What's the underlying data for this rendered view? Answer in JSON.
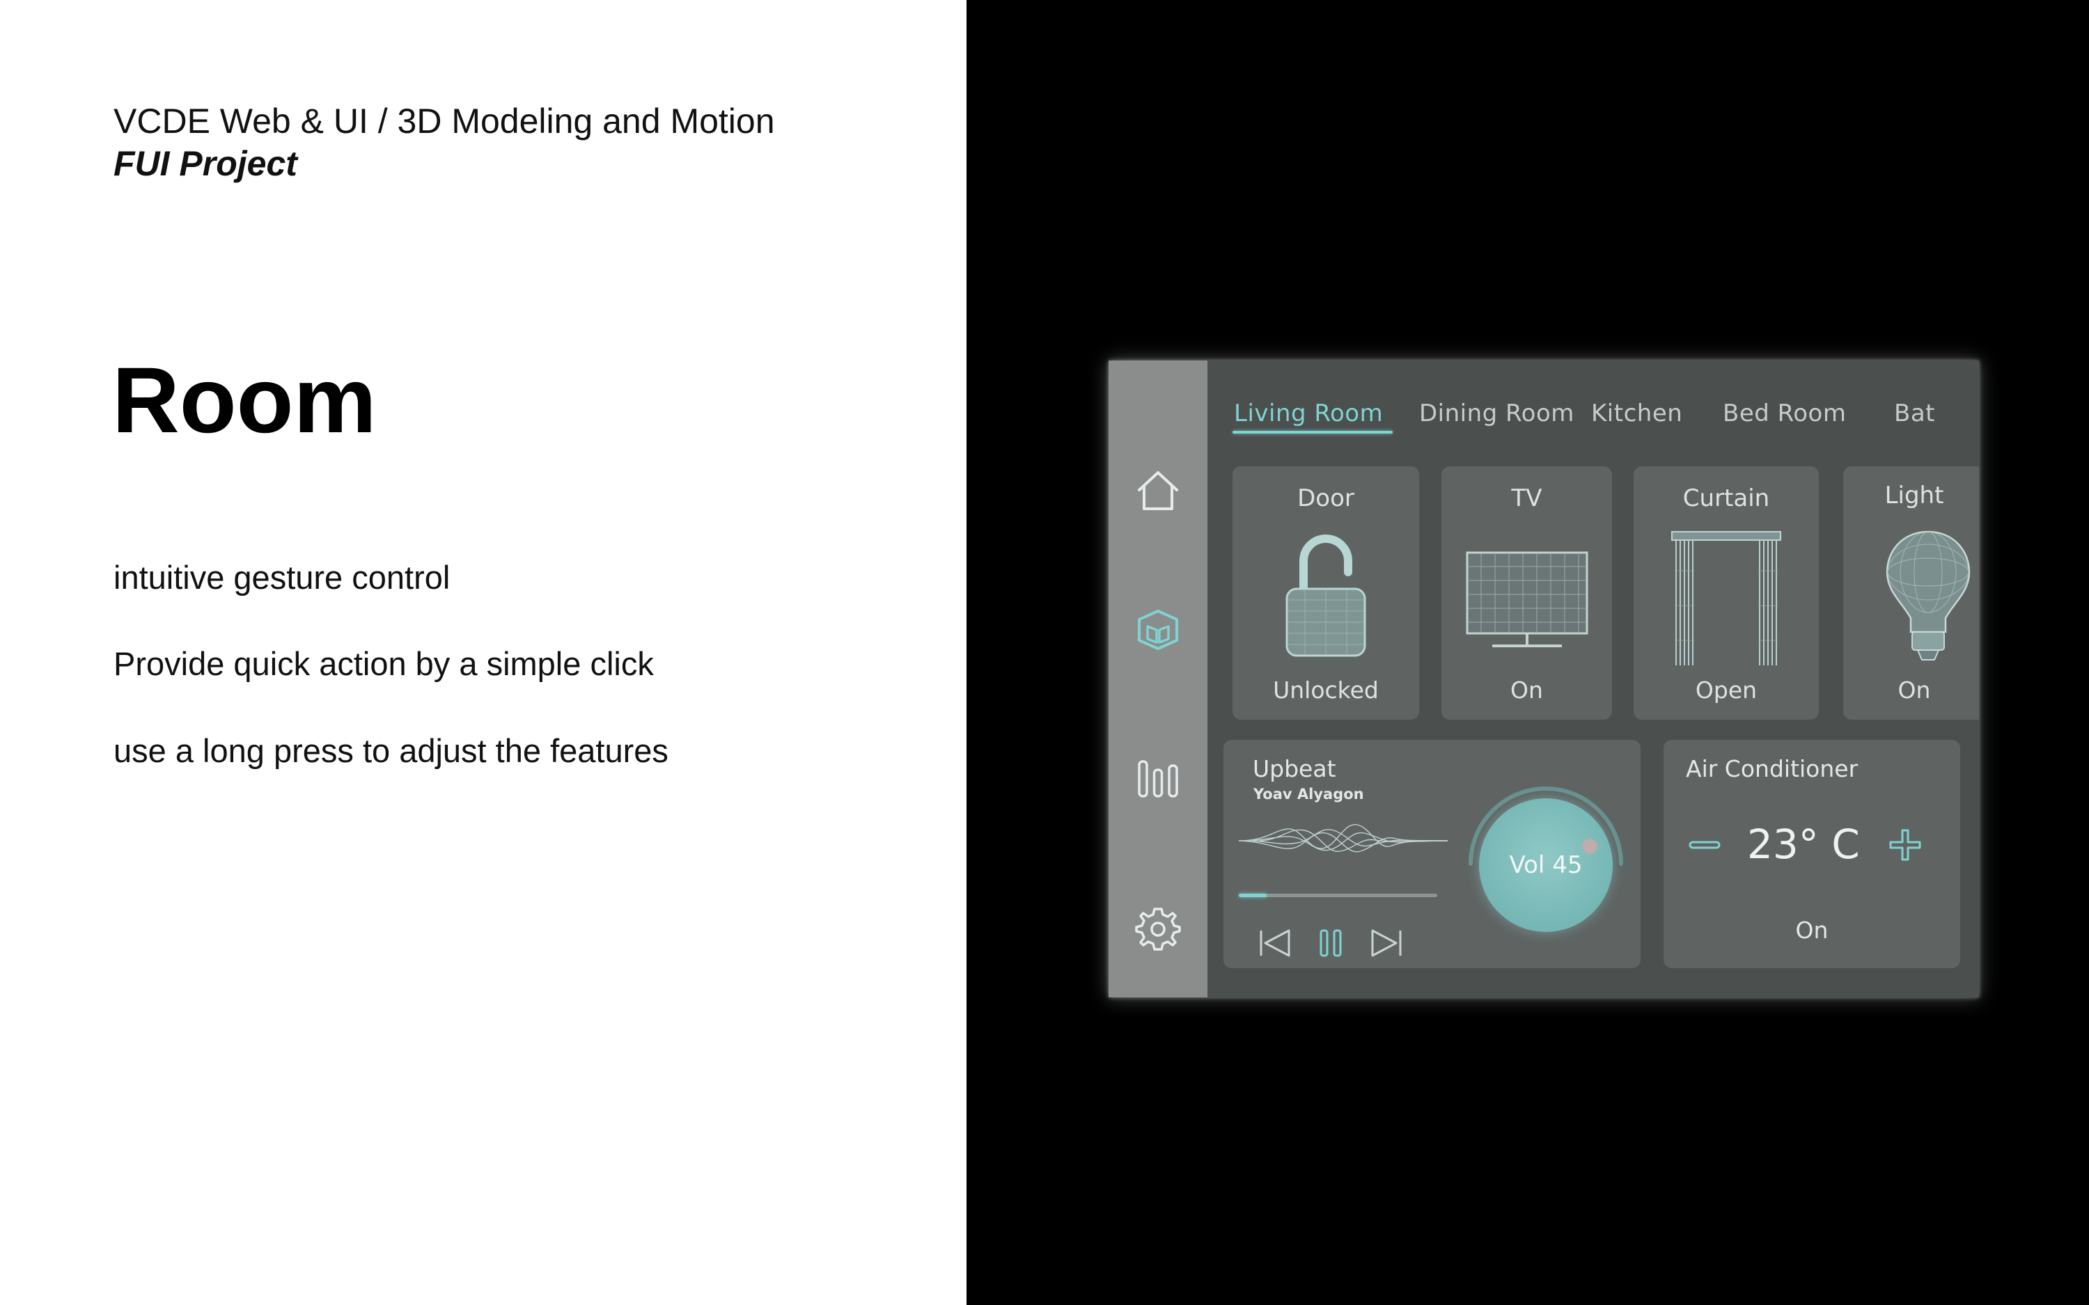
{
  "slide": {
    "course": "VCDE Web & UI / 3D Modeling and Motion",
    "project": "FUI Project",
    "heading": "Room",
    "features": [
      "intuitive gesture control",
      "Provide quick action by a simple click",
      "use a long press to adjust the features"
    ]
  },
  "app": {
    "accent_color": "#7fd3d1",
    "sidebar": {
      "items": [
        {
          "icon": "home-icon",
          "active": false
        },
        {
          "icon": "room-cube-icon",
          "active": true
        },
        {
          "icon": "stats-bars-icon",
          "active": false
        },
        {
          "icon": "gear-icon",
          "active": false
        }
      ]
    },
    "tabs": [
      {
        "label": "Living Room",
        "active": true
      },
      {
        "label": "Dining Room",
        "active": false
      },
      {
        "label": "Kitchen",
        "active": false
      },
      {
        "label": "Bed Room",
        "active": false
      },
      {
        "label": "Bat",
        "active": false
      }
    ],
    "devices": [
      {
        "title": "Door",
        "status": "Unlocked",
        "icon": "padlock-icon"
      },
      {
        "title": "TV",
        "status": "On",
        "icon": "tv-icon"
      },
      {
        "title": "Curtain",
        "status": "Open",
        "icon": "curtain-icon"
      },
      {
        "title": "Light",
        "status": "On",
        "icon": "lightbulb-icon"
      }
    ],
    "music": {
      "title": "Upbeat",
      "artist": "Yoav Alyagon",
      "progress": 0.14,
      "volume_label": "Vol 45",
      "volume": 45,
      "controls": [
        "previous-icon",
        "pause-icon",
        "next-icon"
      ]
    },
    "air_conditioner": {
      "title": "Air Conditioner",
      "temperature": "23° C",
      "status": "On"
    }
  }
}
